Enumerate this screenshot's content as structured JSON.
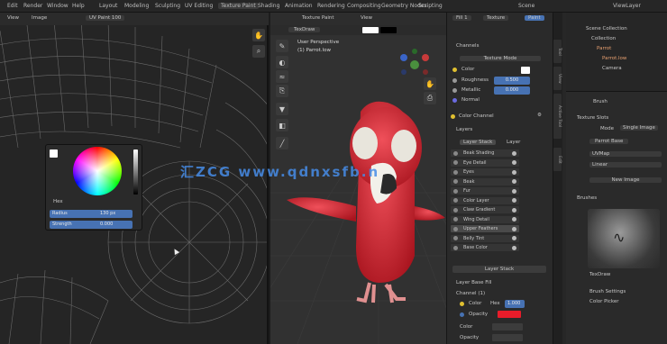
{
  "topbar": {
    "menu": [
      "Edit",
      "Render",
      "Window",
      "Help"
    ],
    "workspaces": [
      "Layout",
      "Modeling",
      "Sculpting",
      "UV Editing",
      "Texture Paint",
      "Shading",
      "Animation",
      "Rendering",
      "Compositing",
      "Geometry Nodes",
      "Scripting"
    ],
    "scene": "Scene",
    "view_layer": "ViewLayer"
  },
  "uv_editor": {
    "header_mode": "View",
    "header_label": "Image",
    "image_name": "UV Paint 100",
    "color_picker": {
      "hex_label": "Hex",
      "fields": [
        {
          "label": "Radius",
          "value": "130 px"
        },
        {
          "label": "Strength",
          "value": "0.000"
        }
      ]
    }
  },
  "viewport": {
    "header_mode": "Texture Paint",
    "header_view": "View",
    "header_brush": "TexDraw",
    "overlay_line1": "User Perspective",
    "overlay_line2": "(1) Parrot.low",
    "watermark": "汇ZCG  www.qdnxsfb.n",
    "tools": [
      "brush",
      "fill",
      "smear",
      "clone",
      "mask",
      "erase",
      "sample",
      "line"
    ]
  },
  "props": {
    "top_tabs": [
      "Fill 1",
      "Texture",
      "Paint"
    ],
    "section_channels": "Channels",
    "texture_mode": "Texture Mode",
    "channel_rows": [
      {
        "label": "Color",
        "value": ""
      },
      {
        "label": "Roughness",
        "value": "0.500"
      },
      {
        "label": "Metallic",
        "value": "0.000"
      },
      {
        "label": "Normal",
        "value": ""
      }
    ],
    "color_channel": "Color Channel",
    "section_layers": "Layers",
    "layer_tabs": [
      "Layer Stack",
      "Layer"
    ],
    "layers": [
      "Beak Shading",
      "Eye Detail",
      "Eyes",
      "Beak",
      "Fur",
      "Color Layer",
      "Claw Gradient",
      "Wing Detail",
      "Upper Feathers",
      "Belly Tint",
      "Base Color"
    ],
    "add_button": "Layer Stack",
    "layer_name": "Layer Base Fill",
    "channel_label": "Channel (1)",
    "color_label": "Color",
    "color_hex": "Hex",
    "color_value": "1.000",
    "opacity_label": "Opacity",
    "rows_bottom": [
      "Color",
      "Opacity"
    ],
    "colors": {
      "channel_swatch": "#e81c2a",
      "accent": "#4772b3"
    }
  },
  "right": {
    "outliner_title": "Scene Collection",
    "outliner_items": [
      "Collection",
      "Parrot",
      "Parrot.low",
      "Camera"
    ],
    "brush_name": "Brush",
    "tab_labels": [
      "Tool",
      "View",
      "Active Tool",
      "Edit"
    ],
    "texture_slots": "Texture Slots",
    "mode": "Mode",
    "mode_value": "Single Image",
    "image_label": "Parrot Base",
    "uv_map": "UVMap",
    "interp": "Linear",
    "new_btn": "New Image",
    "brushes_title": "Brushes",
    "brush_preview_name": "TexDraw",
    "brush_settings": "Brush Settings",
    "brush_color": "Color Picker"
  }
}
